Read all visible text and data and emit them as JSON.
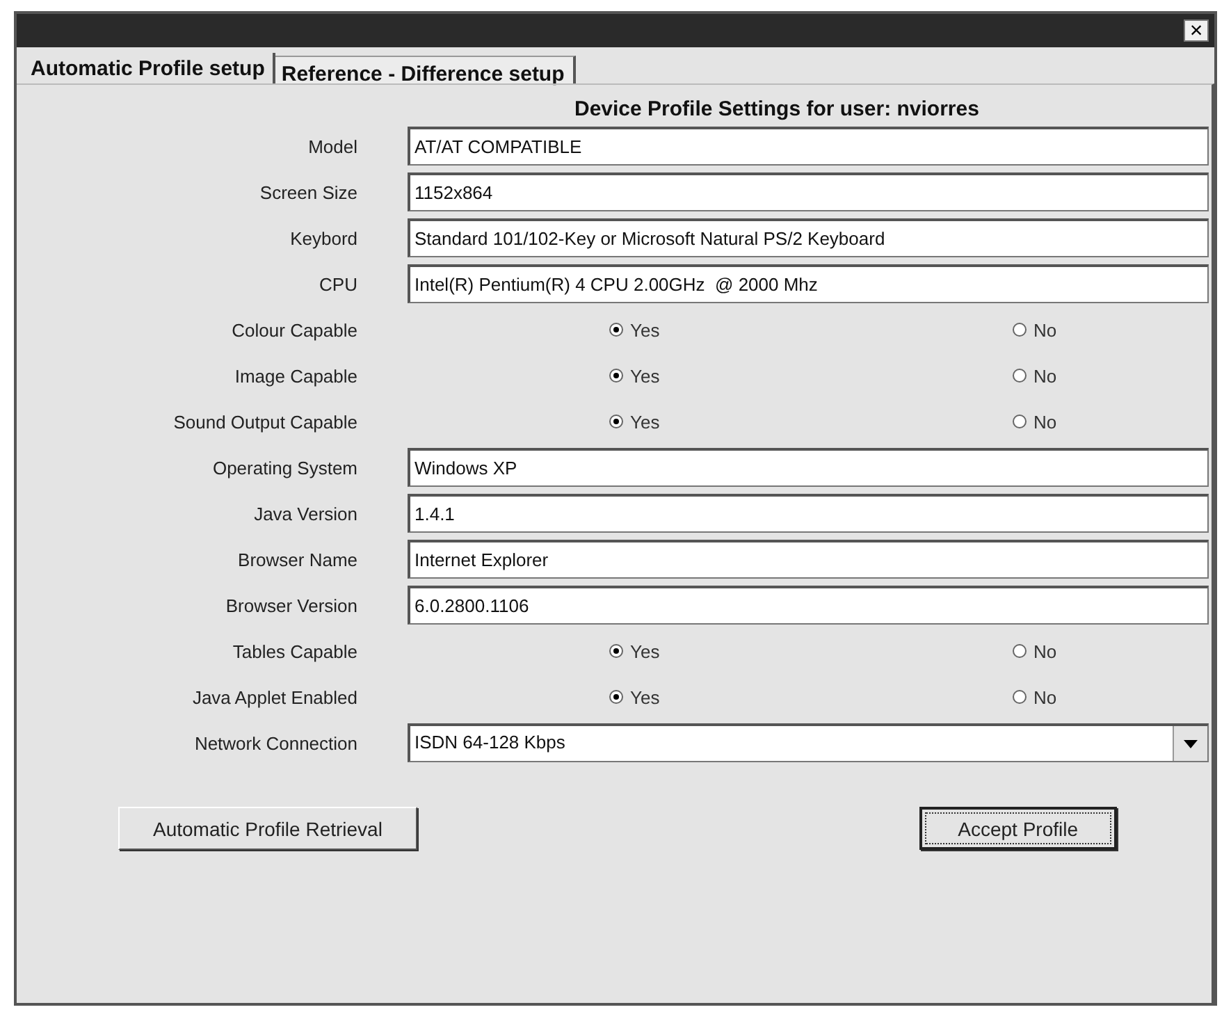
{
  "window": {
    "close_glyph": "×"
  },
  "tabs": [
    {
      "label": "Automatic Profile setup",
      "selected": true
    },
    {
      "label": "Reference - Difference setup",
      "selected": false
    }
  ],
  "heading": "Device Profile Settings for user: nviorres",
  "fields": [
    {
      "kind": "text",
      "label": "Model",
      "value": "AT/AT COMPATIBLE"
    },
    {
      "kind": "text",
      "label": "Screen Size",
      "value": "1152x864"
    },
    {
      "kind": "text",
      "label": "Keybord",
      "value": "Standard 101/102-Key or Microsoft Natural PS/2 Keyboard"
    },
    {
      "kind": "text",
      "label": "CPU",
      "value": "Intel(R) Pentium(R) 4 CPU 2.00GHz  @ 2000 Mhz"
    },
    {
      "kind": "radio",
      "label": "Colour Capable",
      "options": [
        {
          "label": "Yes",
          "selected": true
        },
        {
          "label": "No",
          "selected": false
        }
      ]
    },
    {
      "kind": "radio",
      "label": "Image Capable",
      "options": [
        {
          "label": "Yes",
          "selected": true
        },
        {
          "label": "No",
          "selected": false
        }
      ]
    },
    {
      "kind": "radio",
      "label": "Sound Output Capable",
      "options": [
        {
          "label": "Yes",
          "selected": true
        },
        {
          "label": "No",
          "selected": false
        }
      ]
    },
    {
      "kind": "text",
      "label": "Operating System",
      "value": "Windows XP"
    },
    {
      "kind": "text",
      "label": "Java Version",
      "value": "1.4.1"
    },
    {
      "kind": "text",
      "label": "Browser Name",
      "value": "Internet Explorer"
    },
    {
      "kind": "text",
      "label": "Browser Version",
      "value": "6.0.2800.1106"
    },
    {
      "kind": "radio",
      "label": "Tables Capable",
      "options": [
        {
          "label": "Yes",
          "selected": true
        },
        {
          "label": "No",
          "selected": false
        }
      ]
    },
    {
      "kind": "radio",
      "label": "Java Applet Enabled",
      "options": [
        {
          "label": "Yes",
          "selected": true
        },
        {
          "label": "No",
          "selected": false
        }
      ]
    },
    {
      "kind": "select",
      "label": "Network Connection",
      "value": "ISDN 64-128 Kbps"
    }
  ],
  "buttons": [
    {
      "label": "Automatic Profile Retrieval",
      "focused": false
    },
    {
      "label": "Accept Profile",
      "focused": true
    }
  ]
}
